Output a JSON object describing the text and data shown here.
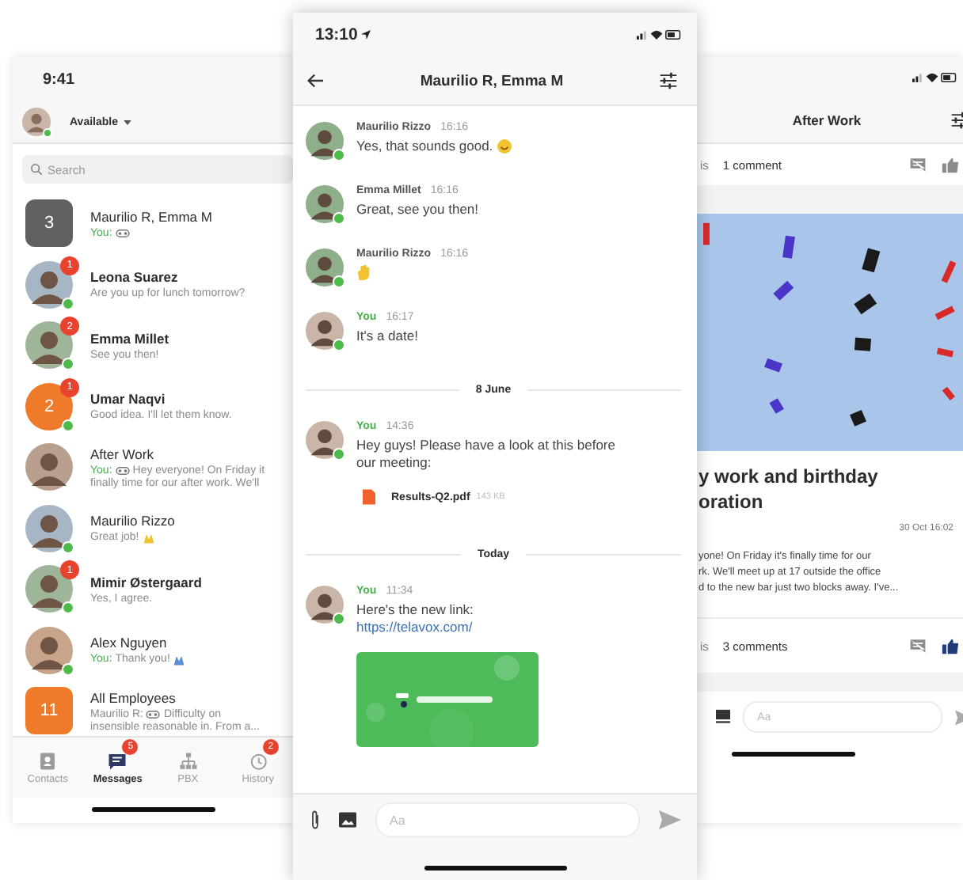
{
  "left_phone": {
    "status_time": "9:41",
    "profile": {
      "status": "Available",
      "online": true
    },
    "search": {
      "placeholder": "Search"
    },
    "conversations": [
      {
        "kind": "group",
        "round": false,
        "color": "#5f6163",
        "count": "3",
        "name": "Maurilio R, Emma M",
        "online": false,
        "sender": "You:",
        "sender_self": true,
        "attachment": true
      },
      {
        "name": "Leona Suarez",
        "unread": "1",
        "online": true,
        "preview": [
          "Are you up for lunch tomorrow?"
        ]
      },
      {
        "name": "Emma Millet",
        "unread": "2",
        "online": true,
        "preview": [
          "See you then!"
        ]
      },
      {
        "kind": "group",
        "round": true,
        "color": "#ef7a2a",
        "count": "2",
        "name": "Umar Naqvi",
        "unread": "1",
        "online": true,
        "preview": [
          "Good idea. I'll let them know."
        ]
      },
      {
        "name": "After Work",
        "online": false,
        "sender": "You:",
        "sender_self": true,
        "attachment": true,
        "preview": [
          "Hey everyone! On Friday it",
          "finally time for our after work. We'll"
        ]
      },
      {
        "name": "Maurilio Rizzo",
        "online": true,
        "preview": [
          "Great job!"
        ],
        "emoji": {
          "kind": "hands"
        }
      },
      {
        "name": "Mimir Østergaard",
        "unread": "1",
        "online": true,
        "preview": [
          "Yes, I agree."
        ]
      },
      {
        "name": "Alex Nguyen",
        "online": true,
        "sender": "You:",
        "sender_self": true,
        "preview": [
          "Thank you!"
        ],
        "emoji": {
          "kind": "pray"
        }
      },
      {
        "kind": "group",
        "round": false,
        "color": "#ef7a2a",
        "count": "11",
        "name": "All Employees",
        "online": false,
        "sender": "Maurilio R:",
        "sender_self": false,
        "attachment": true,
        "preview": [
          "Difficulty on",
          "insensible reasonable in. From a..."
        ]
      }
    ],
    "tabs": [
      {
        "kind": "contacts",
        "label": "Contacts",
        "selected": false
      },
      {
        "kind": "messages",
        "label": "Messages",
        "selected": true,
        "badge": "5"
      },
      {
        "kind": "pbx",
        "label": "PBX",
        "selected": false
      },
      {
        "kind": "history",
        "label": "History",
        "selected": false,
        "badge": "2"
      }
    ]
  },
  "middle_phone": {
    "status_time": "13:10",
    "title": "Maurilio R, Emma M",
    "messages": [
      {
        "kind": "message",
        "sender": "Maurilio Rizzo",
        "self": false,
        "time": "16:16",
        "online": true,
        "text": "Yes, that sounds good.",
        "emoji": {
          "kind": "smile"
        }
      },
      {
        "kind": "message",
        "sender": "Emma Millet",
        "self": false,
        "time": "16:16",
        "online": true,
        "text": "Great, see you then!"
      },
      {
        "kind": "message",
        "sender": "Maurilio Rizzo",
        "self": false,
        "time": "16:16",
        "online": true,
        "emoji": {
          "kind": "wave"
        }
      },
      {
        "kind": "message",
        "sender": "You",
        "self": true,
        "time": "16:17",
        "online": true,
        "text": "It's a date!"
      },
      {
        "kind": "divider",
        "label": "8 June"
      },
      {
        "kind": "message",
        "sender": "You",
        "self": true,
        "time": "14:36",
        "online": true,
        "text": "Hey guys! Please have a look at this before our meeting:",
        "file": {
          "name": "Results-Q2.pdf",
          "size": "143 KB"
        }
      },
      {
        "kind": "divider",
        "label": "Today"
      },
      {
        "kind": "message",
        "sender": "You",
        "self": true,
        "time": "11:34",
        "online": true,
        "text": "Here's the new link:",
        "link": "https://telavox.com/",
        "preview": {
          "kind": "picture"
        }
      }
    ],
    "composer": {
      "placeholder": "Aa"
    }
  },
  "right_phone": {
    "title": "After Work",
    "top_stats": {
      "left": "is",
      "comments": "1 comment",
      "liked": false
    },
    "picture": {
      "kind": "picture"
    },
    "post_title": [
      "y work and birthday",
      "oration"
    ],
    "date": "30 Oct 16:02",
    "body": [
      "yone! On Friday it's finally time for our",
      "rk. We'll meet up at 17 outside the office",
      "d to the new bar just two blocks away. I've..."
    ],
    "bottom_stats": {
      "left": "is",
      "comments": "3 comments",
      "liked": true
    },
    "composer": {
      "placeholder": "Aa"
    }
  }
}
